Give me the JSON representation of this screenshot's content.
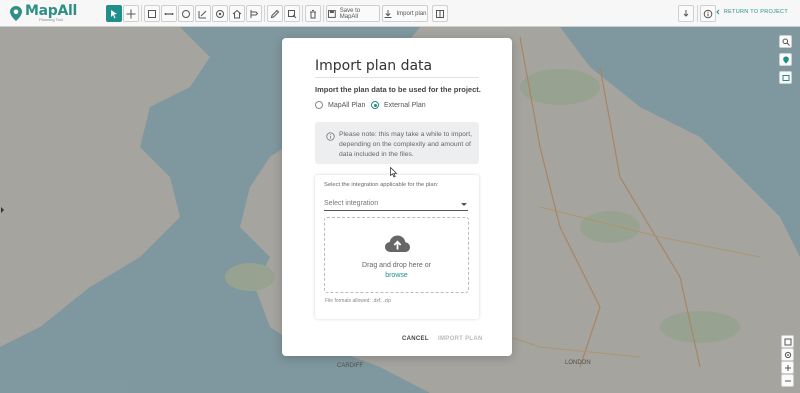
{
  "app": {
    "name": "MapAll",
    "tagline": "Planning Tool"
  },
  "toolbar": {
    "buttons": [
      {
        "icon": "select-icon",
        "active": true
      },
      {
        "icon": "move-icon",
        "active": false
      },
      {
        "icon": "rectangle-icon",
        "active": false
      },
      {
        "icon": "line-icon",
        "active": false
      },
      {
        "icon": "circle-icon",
        "active": false
      },
      {
        "icon": "measure-icon",
        "active": false
      },
      {
        "icon": "target-icon",
        "active": false
      },
      {
        "icon": "home-icon",
        "active": false
      },
      {
        "icon": "route-icon",
        "active": false
      },
      {
        "icon": "pencil-icon",
        "active": false
      },
      {
        "icon": "transform-icon",
        "active": false
      },
      {
        "icon": "trash-icon",
        "active": false
      },
      {
        "icon": "layout-icon",
        "active": false
      }
    ],
    "save_label": "Save to MapAll",
    "import_label": "Import plan",
    "return_label": "RETURN TO PROJECT"
  },
  "modal": {
    "title": "Import plan data",
    "subtitle": "Import the plan data to be used for the project.",
    "radio_mapall": "MapAll Plan",
    "radio_external": "External Plan",
    "selected_option": "External Plan",
    "note": "Please note: this may take a while to import, depending on the complexity and amount of data included in the files.",
    "integration_label": "Select the integration applicable for the plan:",
    "integration_placeholder": "Select integration",
    "drop_text": "Drag and drop here or",
    "browse_link": "browse",
    "formats": "File formats allowed: .dxf, .zip",
    "cancel_label": "CANCEL",
    "import_label": "IMPORT PLAN"
  },
  "map_labels": {
    "cardiff": "CARDIFF",
    "london": "LONDON"
  },
  "colors": {
    "accent": "#1f8f8a",
    "map_land": "#ede9e0",
    "map_sea": "#aad3df"
  }
}
